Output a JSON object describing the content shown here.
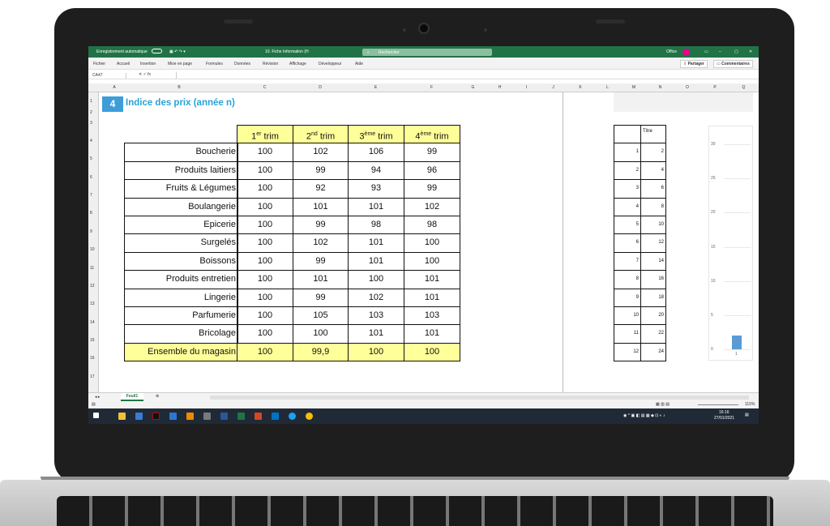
{
  "excel": {
    "autosave_label": "Enregistrement automatique",
    "file_name": "10. Fiche Information (H",
    "search_placeholder": "Rechercher",
    "office_label": "Office",
    "share_label": "Partager",
    "comments_label": "Commentaires",
    "menu": [
      "Fichier",
      "Accueil",
      "Insertion",
      "Mise en page",
      "Formules",
      "Données",
      "Révision",
      "Affichage",
      "Développeur",
      "Aide"
    ],
    "name_box": "CA47",
    "columns": [
      "A",
      "B",
      "C",
      "D",
      "E",
      "F",
      "G",
      "H",
      "I",
      "J",
      "K",
      "L",
      "M",
      "N",
      "O",
      "P",
      "Q"
    ],
    "rows": [
      "1",
      "2",
      "3",
      "4",
      "5",
      "6",
      "7",
      "8",
      "9",
      "10",
      "11",
      "12",
      "13",
      "14",
      "15",
      "16",
      "17"
    ],
    "sheet_tab": "Feuil1",
    "zoom": "115%"
  },
  "section": {
    "number": "4",
    "title": "Indice des prix (année n)"
  },
  "table": {
    "headers": [
      {
        "n": "1",
        "sup": "er",
        "rest": " trim"
      },
      {
        "n": "2",
        "sup": "nd",
        "rest": " trim"
      },
      {
        "n": "3",
        "sup": "ème",
        "rest": " trim"
      },
      {
        "n": "4",
        "sup": "ème",
        "rest": " trim"
      }
    ],
    "rows": [
      {
        "label": "Boucherie",
        "values": [
          "100",
          "102",
          "106",
          "99"
        ]
      },
      {
        "label": "Produits laitiers",
        "values": [
          "100",
          "99",
          "94",
          "96"
        ]
      },
      {
        "label": "Fruits & Légumes",
        "values": [
          "100",
          "92",
          "93",
          "99"
        ]
      },
      {
        "label": "Boulangerie",
        "values": [
          "100",
          "101",
          "101",
          "102"
        ]
      },
      {
        "label": "Epicerie",
        "values": [
          "100",
          "99",
          "98",
          "98"
        ]
      },
      {
        "label": "Surgelés",
        "values": [
          "100",
          "102",
          "101",
          "100"
        ]
      },
      {
        "label": "Boissons",
        "values": [
          "100",
          "99",
          "101",
          "100"
        ]
      },
      {
        "label": "Produits entretien",
        "values": [
          "100",
          "101",
          "100",
          "101"
        ]
      },
      {
        "label": "Lingerie",
        "values": [
          "100",
          "99",
          "102",
          "101"
        ]
      },
      {
        "label": "Parfumerie",
        "values": [
          "100",
          "105",
          "103",
          "103"
        ]
      },
      {
        "label": "Bricolage",
        "values": [
          "100",
          "100",
          "101",
          "101"
        ]
      }
    ],
    "total": {
      "label": "Ensemble du magasin",
      "values": [
        "100",
        "99,9",
        "100",
        "100"
      ]
    }
  },
  "side_table": {
    "header": "Titre",
    "rows": [
      [
        "1",
        "2"
      ],
      [
        "2",
        "4"
      ],
      [
        "3",
        "6"
      ],
      [
        "4",
        "8"
      ],
      [
        "5",
        "10"
      ],
      [
        "6",
        "12"
      ],
      [
        "7",
        "14"
      ],
      [
        "8",
        "16"
      ],
      [
        "9",
        "18"
      ],
      [
        "10",
        "20"
      ],
      [
        "11",
        "22"
      ],
      [
        "12",
        "24"
      ]
    ]
  },
  "chart_data": {
    "type": "bar",
    "categories": [
      "1"
    ],
    "values": [
      2
    ],
    "ylim": [
      0,
      30
    ],
    "yticks": [
      "0",
      "5",
      "10",
      "15",
      "20",
      "25",
      "30"
    ]
  },
  "clock": {
    "time": "16:16",
    "date": "27/01/2021"
  },
  "colors": {
    "excel_green": "#217346",
    "title_blue": "#2aa3d4",
    "highlight_yellow": "#ffff99",
    "bar_blue": "#5b9bd5"
  }
}
